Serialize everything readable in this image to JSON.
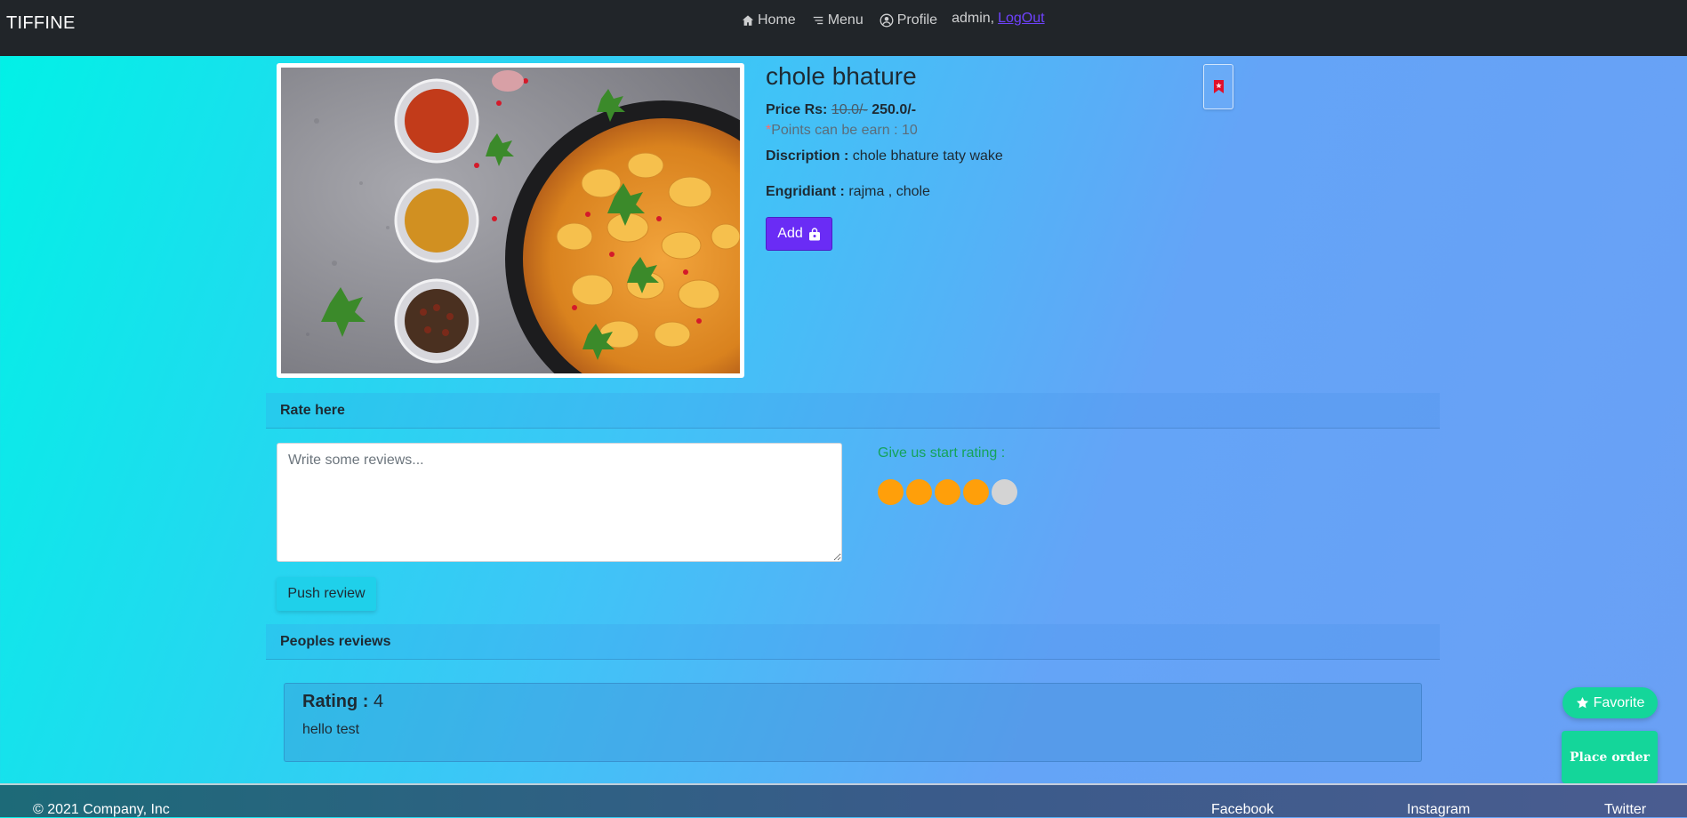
{
  "navbar": {
    "brand": "TIFFINE",
    "links": [
      {
        "label": "Home",
        "icon": "home-icon"
      },
      {
        "label": "Menu",
        "icon": "menu-lines-icon"
      },
      {
        "label": "Profile",
        "icon": "user-circle-icon"
      }
    ],
    "user": "admin,",
    "logout": "LogOut"
  },
  "product": {
    "name": "chole bhature",
    "price_label": "Price Rs:",
    "old_price": "10.0/-",
    "new_price": "250.0/-",
    "points_star": "*",
    "points_text": "Points can be earn : 10",
    "description_label": "Discription :",
    "description": "chole bhature taty wake",
    "ingredients_label": "Engridiant :",
    "ingredients": "rajma , chole",
    "add_label": "Add"
  },
  "rate_section": {
    "title": "Rate here",
    "review_placeholder": "Write some reviews...",
    "push_label": "Push review",
    "rating_prompt": "Give us start rating :",
    "selected_rating": 4,
    "max_rating": 5
  },
  "reviews_section": {
    "title": "Peoples reviews",
    "reviews": [
      {
        "rating_label": "Rating :",
        "rating": "4",
        "text": "hello test"
      }
    ]
  },
  "floating": {
    "favorite_label": "Favorite",
    "order_label": "Place order"
  },
  "footer": {
    "copyright": "© 2021 Company, Inc",
    "links": [
      "Facebook",
      "Instagram",
      "Twitter"
    ]
  },
  "colors": {
    "navbar": "#212529",
    "accent_purple": "#6a2cf5",
    "accent_green": "#14d69a",
    "star_active": "#ff9f0a",
    "star_inactive": "#d4d4d4"
  }
}
